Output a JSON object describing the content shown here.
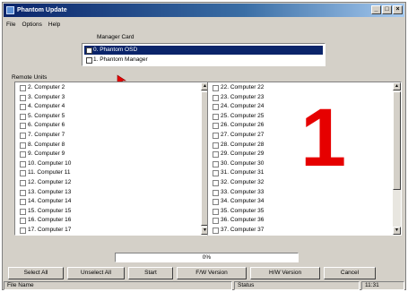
{
  "window": {
    "title": "Phantom Update",
    "controls": [
      "_",
      "□",
      "×"
    ]
  },
  "menu": [
    "File",
    "Options",
    "Help"
  ],
  "manager_card": {
    "label": "Manager Card",
    "items": [
      {
        "label": "0. Phantom OSD",
        "selected": true
      },
      {
        "label": "1. Phantom Manager",
        "selected": false
      }
    ]
  },
  "remote_units": {
    "label": "Remote Units",
    "left": [
      "2. Computer 2",
      "3. Computer 3",
      "4. Computer 4",
      "5. Computer 5",
      "6. Computer 6",
      "7. Computer 7",
      "8. Computer 8",
      "9. Computer 9",
      "10. Computer 10",
      "11. Computer 11",
      "12. Computer 12",
      "13. Computer 13",
      "14. Computer 14",
      "15. Computer 15",
      "16. Computer 16",
      "17. Computer 17"
    ],
    "right": [
      "22. Computer 22",
      "23. Computer 23",
      "24. Computer 24",
      "25. Computer 25",
      "26. Computer 26",
      "27. Computer 27",
      "28. Computer 28",
      "29. Computer 29",
      "30. Computer 30",
      "31. Computer 31",
      "32. Computer 32",
      "33. Computer 33",
      "34. Computer 34",
      "35. Computer 35",
      "36. Computer 36",
      "37. Computer 37"
    ]
  },
  "overlay_number": "1",
  "progress": {
    "text": "0%",
    "value": 0
  },
  "buttons": {
    "select_all": "Select All",
    "unselect_all": "Unselect All",
    "start": "Start",
    "fw_version": "F/W Version",
    "hw_version": "H/W Version",
    "cancel": "Cancel"
  },
  "status_bar": {
    "file_name": "File Name",
    "status": "Status",
    "time": "11:31"
  },
  "colors": {
    "title_bar": "#0a246a",
    "selection": "#0a246a",
    "overlay_number": "#e60000",
    "face": "#d4d0c8"
  }
}
